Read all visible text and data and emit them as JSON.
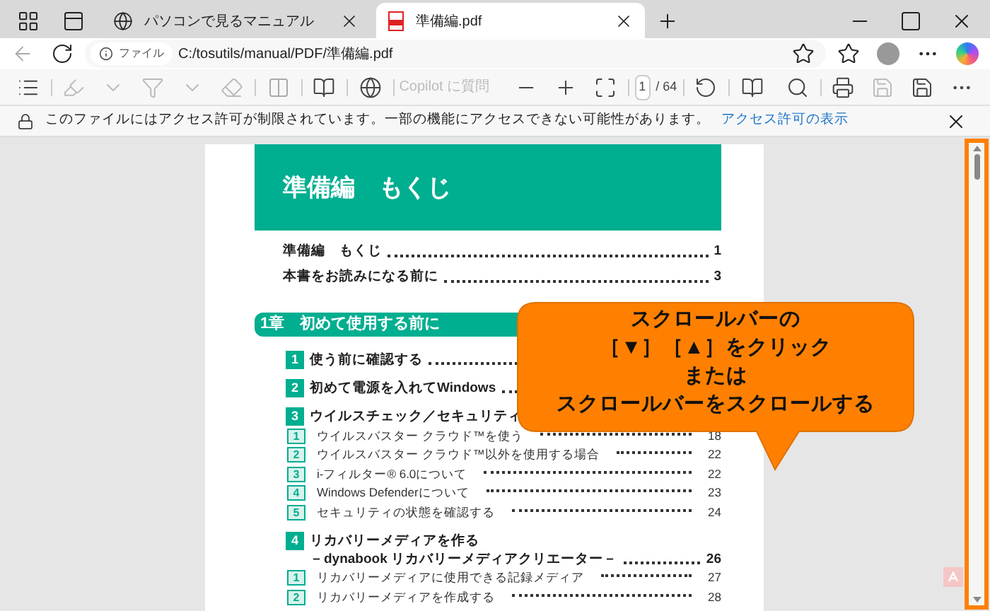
{
  "tabs": [
    {
      "title": "パソコンで見るマニュアル",
      "selected": false
    },
    {
      "title": "準備編.pdf",
      "selected": true
    }
  ],
  "address": {
    "scheme": "ファイル",
    "url": "C:/tosutils/manual/PDF/準備編.pdf"
  },
  "pdf_toolbar": {
    "copilot_placeholder": "Copilot に質問",
    "page": "1",
    "page_total": "/ 64"
  },
  "info_bar": {
    "message": "このファイルにはアクセス許可が制限されています。一部の機能にアクセスできない可能性があります。",
    "link": "アクセス許可の表示"
  },
  "document": {
    "title": "準備編　もくじ",
    "entries": [
      {
        "label": "準備編　もくじ",
        "page": "1"
      },
      {
        "label": "本書をお読みになる前に",
        "page": "3"
      }
    ],
    "chapter": "1章　初めて使用する前に",
    "sections": [
      {
        "number": "1",
        "lines": [
          "使う前に確認する"
        ]
      },
      {
        "number": "2",
        "lines": [
          "初めて電源を入れてWindows"
        ]
      },
      {
        "number": "3",
        "lines": [
          "ウイルスチェック／セキュリティ"
        ],
        "children": [
          {
            "number": "1",
            "label": "ウイルスバスター クラウド™を使う",
            "page": "18"
          },
          {
            "number": "2",
            "label": "ウイルスバスター クラウド™以外を使用する場合",
            "page": "22"
          },
          {
            "number": "3",
            "label": "i-フィルター® 6.0について",
            "page": "22"
          },
          {
            "number": "4",
            "label": "Windows Defenderについて",
            "page": "23"
          },
          {
            "number": "5",
            "label": "セキュリティの状態を確認する",
            "page": "24"
          }
        ]
      },
      {
        "number": "4",
        "lines": [
          "リカバリーメディアを作る",
          "－dynabook リカバリーメディアクリエーター－"
        ],
        "page": "26",
        "children": [
          {
            "number": "1",
            "label": "リカバリーメディアに使用できる記録メディア",
            "page": "27"
          },
          {
            "number": "2",
            "label": "リカバリーメディアを作成する",
            "page": "28"
          }
        ]
      }
    ]
  },
  "callout": [
    "スクロールバーの",
    "［▼］［▲］をクリック",
    "または",
    "スクロールバーをスクロールする"
  ]
}
